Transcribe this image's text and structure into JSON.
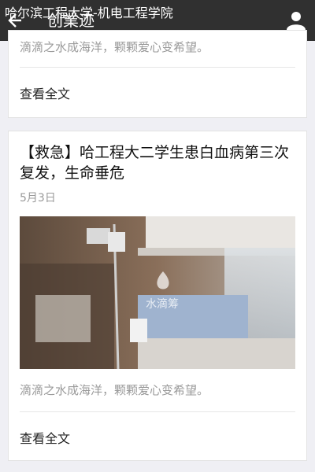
{
  "header": {
    "source": "哈尔滨工程大学-机电工程学院",
    "title": "创業迹",
    "back_icon": "back-arrow-icon",
    "profile_icon": "person-icon"
  },
  "article1": {
    "excerpt": "滴滴之水成海洋，颗颗爱心变希望。",
    "read_more": "查看全文"
  },
  "article2": {
    "title": "【救急】哈工程大二学生患白血病第三次复发，生命垂危",
    "date": "5月3日",
    "image_watermark": "水滴筹",
    "excerpt": "滴滴之水成海洋，颗颗爱心变希望。",
    "read_more": "查看全文"
  }
}
